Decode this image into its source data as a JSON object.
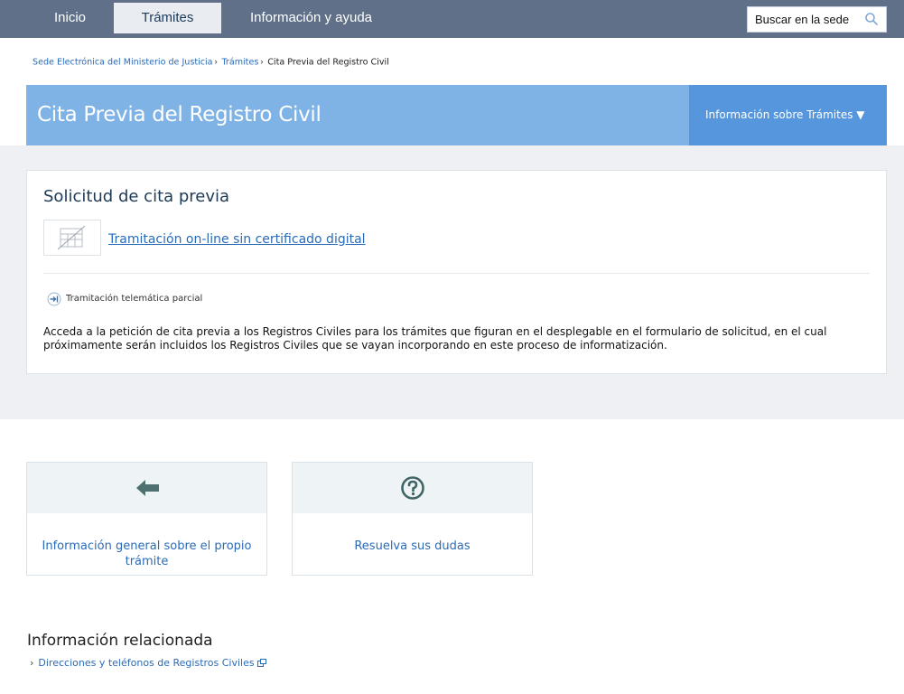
{
  "nav": {
    "items": [
      {
        "label": "Inicio"
      },
      {
        "label": "Trámites"
      },
      {
        "label": "Información y ayuda"
      }
    ],
    "search_label": "Buscar en la sede",
    "search_icon": "search-icon"
  },
  "breadcrumb": {
    "items": [
      {
        "label": "Sede Electrónica del Ministerio de Justicia"
      },
      {
        "label": "Trámites"
      }
    ],
    "separator": "›",
    "current": "Cita Previa del Registro Civil"
  },
  "banner": {
    "title": "Cita Previa del Registro Civil",
    "side_label": "Información sobre Trámites ▼"
  },
  "card": {
    "title": "Solicitud de cita previa",
    "method_link": "Tramitación on-line sin certificado digital",
    "method_icon": "no-certificate-icon",
    "tele_label": "Tramitación telemática parcial",
    "tele_icon": "partial-arrow-icon",
    "description": "Acceda a la petición de cita previa a los Registros Civiles para los trámites que figuran en el desplegable en el formulario de solicitud, en el cual próximamente serán incluidos los Registros Civiles que se vayan incorporando en este proceso de informatización."
  },
  "tiles": [
    {
      "label": "Información general sobre el propio trámite",
      "icon": "arrow-left-icon"
    },
    {
      "label": "Resuelva sus dudas",
      "icon": "question-circle-icon"
    }
  ],
  "related": {
    "title": "Información relacionada",
    "chevron": "›",
    "link": "Direcciones y teléfonos de Registros Civiles",
    "link_icon": "external-link-icon"
  },
  "colors": {
    "nav_bg": "#5f7088",
    "banner_bg": "#7fb3e5",
    "banner_side_bg": "#5596dc",
    "link": "#2a6bb8",
    "band_bg": "#eef0f3"
  }
}
